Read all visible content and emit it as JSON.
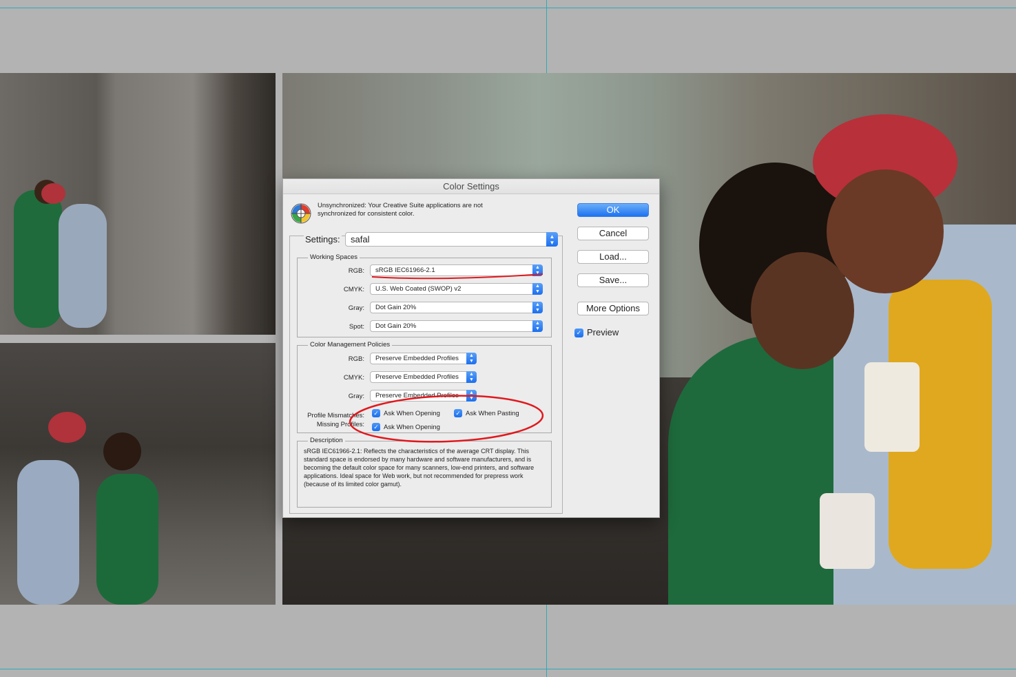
{
  "dialog": {
    "title": "Color Settings",
    "sync_message": "Unsynchronized: Your Creative Suite applications are not synchronized for consistent color.",
    "settings_label": "Settings:",
    "settings_value": "safal",
    "working_spaces": {
      "title": "Working Spaces",
      "rows": [
        {
          "label": "RGB:",
          "value": "sRGB IEC61966-2.1"
        },
        {
          "label": "CMYK:",
          "value": "U.S. Web Coated (SWOP) v2"
        },
        {
          "label": "Gray:",
          "value": "Dot Gain 20%"
        },
        {
          "label": "Spot:",
          "value": "Dot Gain 20%"
        }
      ]
    },
    "policies": {
      "title": "Color Management Policies",
      "rows": [
        {
          "label": "RGB:",
          "value": "Preserve Embedded Profiles"
        },
        {
          "label": "CMYK:",
          "value": "Preserve Embedded Profiles"
        },
        {
          "label": "Gray:",
          "value": "Preserve Embedded Profiles"
        }
      ],
      "profile_mismatches_label": "Profile Mismatches:",
      "ask_when_opening_label": "Ask When Opening",
      "ask_when_pasting_label": "Ask When Pasting",
      "missing_profiles_label": "Missing Profiles:",
      "missing_ask_when_opening_label": "Ask When Opening",
      "ask_when_opening_checked": true,
      "ask_when_pasting_checked": true,
      "missing_ask_when_opening_checked": true
    },
    "description": {
      "title": "Description",
      "text": "sRGB IEC61966-2.1:  Reflects the characteristics of the average CRT display. This standard space is endorsed by many hardware and software manufacturers, and is becoming the default color space for many scanners, low-end printers, and software applications.  Ideal space for Web work, but not recommended for prepress work (because of its limited color gamut)."
    },
    "buttons": {
      "ok": "OK",
      "cancel": "Cancel",
      "load": "Load...",
      "save": "Save...",
      "more_options": "More Options"
    },
    "preview_label": "Preview",
    "preview_checked": true
  },
  "colors": {
    "accent_blue": "#1e72f0",
    "annotation_red": "#e0191e",
    "guide_cyan": "#2fa8b8",
    "canvas_gray": "#b3b3b3"
  },
  "icons": {
    "checkbox_check": "✓",
    "popup_arrows": "▲▼",
    "color_wheel": "color-wheel-icon"
  }
}
